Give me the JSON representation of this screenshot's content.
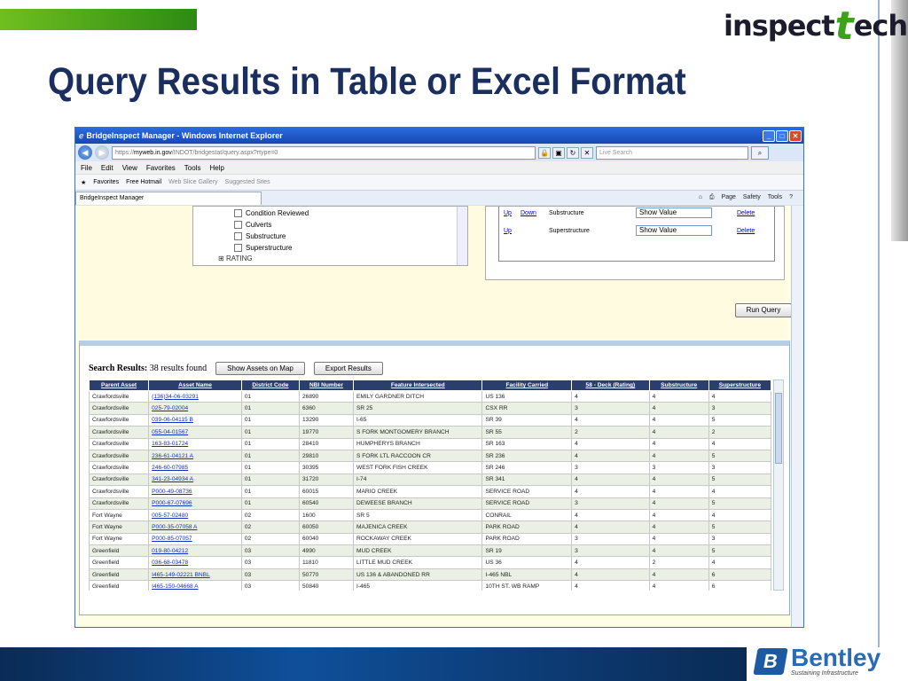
{
  "slide": {
    "title": "Query Results in Table or Excel Format",
    "logo_pre": "inspect",
    "logo_t": "t",
    "logo_post": "ech",
    "brand_name": "Bentley",
    "brand_tagline": "Sustaining Infrastructure",
    "colors": {
      "title": "#1b2f5e",
      "accent_green": "#3aa31b",
      "footer_blue": "#0f4f9a"
    }
  },
  "browser": {
    "window_title": "BridgeInspect Manager - Windows Internet Explorer",
    "address_prefix": "https://",
    "address_host": "myweb.in.gov",
    "address_path": "/INDOT/bridgestat/query.aspx?rtype=0",
    "live_search_placeholder": "Live Search",
    "menu": [
      "File",
      "Edit",
      "View",
      "Favorites",
      "Tools",
      "Help"
    ],
    "favorites_label": "Favorites",
    "fav_links": [
      "Free Hotmail",
      "Web Slice Gallery",
      "Suggested Sites"
    ],
    "tab_label": "BridgeInspect Manager",
    "tab_tools": [
      "Page",
      "Safety",
      "Tools"
    ]
  },
  "criteria_tree": {
    "items": [
      "Condition Reviewed",
      "Culverts",
      "Substructure",
      "Superstructure"
    ],
    "rating_node": "RATING"
  },
  "sort_panel": {
    "rows": [
      {
        "up": "Up",
        "down": "Down",
        "field": "Substructure",
        "select": "Show Value",
        "delete": "Delete"
      },
      {
        "up": "Up",
        "down": "",
        "field": "Superstructure",
        "select": "Show Value",
        "delete": "Delete"
      }
    ]
  },
  "run_query_label": "Run Query",
  "results": {
    "label": "Search Results:",
    "count_text": "38 results found",
    "show_map_label": "Show Assets on Map",
    "export_label": "Export Results",
    "columns": [
      "Parent Asset",
      "Asset Name",
      "District Code",
      "NBI Number",
      "Feature Intersected",
      "Facility Carried",
      "58 - Deck (Rating)",
      "Substructure",
      "Superstructure"
    ],
    "rows": [
      [
        "Crawfordsville",
        "(136)34-06-03291",
        "01",
        "26890",
        "EMILY GARDNER DITCH",
        "US 136",
        "4",
        "4",
        "4"
      ],
      [
        "Crawfordsville",
        "025-79-02004",
        "01",
        "6360",
        "SR 25",
        "CSX RR",
        "3",
        "4",
        "3"
      ],
      [
        "Crawfordsville",
        "039-06-04115 B",
        "01",
        "13290",
        "I-65",
        "SR 39",
        "4",
        "4",
        "5"
      ],
      [
        "Crawfordsville",
        "055-04-01567",
        "01",
        "19770",
        "S FORK MONTGOMERY BRANCH",
        "SR 55",
        "2",
        "4",
        "2"
      ],
      [
        "Crawfordsville",
        "163-83-01724",
        "01",
        "28410",
        "HUMPHERYS BRANCH",
        "SR 163",
        "4",
        "4",
        "4"
      ],
      [
        "Crawfordsville",
        "236-61-04121 A",
        "01",
        "29810",
        "S FORK LTL RACCOON CR",
        "SR 236",
        "4",
        "4",
        "5"
      ],
      [
        "Crawfordsville",
        "246-60-07985",
        "01",
        "30395",
        "WEST FORK FISH CREEK",
        "SR 246",
        "3",
        "3",
        "3"
      ],
      [
        "Crawfordsville",
        "341-23-04934 A",
        "01",
        "31720",
        "I-74",
        "SR 341",
        "4",
        "4",
        "5"
      ],
      [
        "Crawfordsville",
        "P000-49-08736",
        "01",
        "60015",
        "MARIO CREEK",
        "SERVICE ROAD",
        "4",
        "4",
        "4"
      ],
      [
        "Crawfordsville",
        "P000-67-07696",
        "01",
        "60540",
        "DEWEESE BRANCH",
        "SERVICE ROAD",
        "3",
        "4",
        "5"
      ],
      [
        "Fort Wayne",
        "005-57-02480",
        "02",
        "1600",
        "SR 5",
        "CONRAIL",
        "4",
        "4",
        "4"
      ],
      [
        "Fort Wayne",
        "P000-35-07058 A",
        "02",
        "60050",
        "MAJENICA CREEK",
        "PARK ROAD",
        "4",
        "4",
        "5"
      ],
      [
        "Fort Wayne",
        "P000-85-07057",
        "02",
        "60040",
        "ROCKAWAY CREEK",
        "PARK ROAD",
        "3",
        "4",
        "3"
      ],
      [
        "Greenfield",
        "019-80-04212",
        "03",
        "4990",
        "MUD CREEK",
        "SR 19",
        "3",
        "4",
        "5"
      ],
      [
        "Greenfield",
        "036-68-03478",
        "03",
        "11810",
        "LITTLE MUD CREEK",
        "US 36",
        "4",
        "2",
        "4"
      ],
      [
        "Greenfield",
        "I465-149-02221 BNBL",
        "03",
        "50770",
        "US 136 & ABANDONED RR",
        "I-465 NBL",
        "4",
        "4",
        "6"
      ],
      [
        "Greenfield",
        "I465-150-04668 A",
        "03",
        "50840",
        "I-465",
        "10TH ST. WB RAMP",
        "4",
        "4",
        "6"
      ]
    ]
  }
}
